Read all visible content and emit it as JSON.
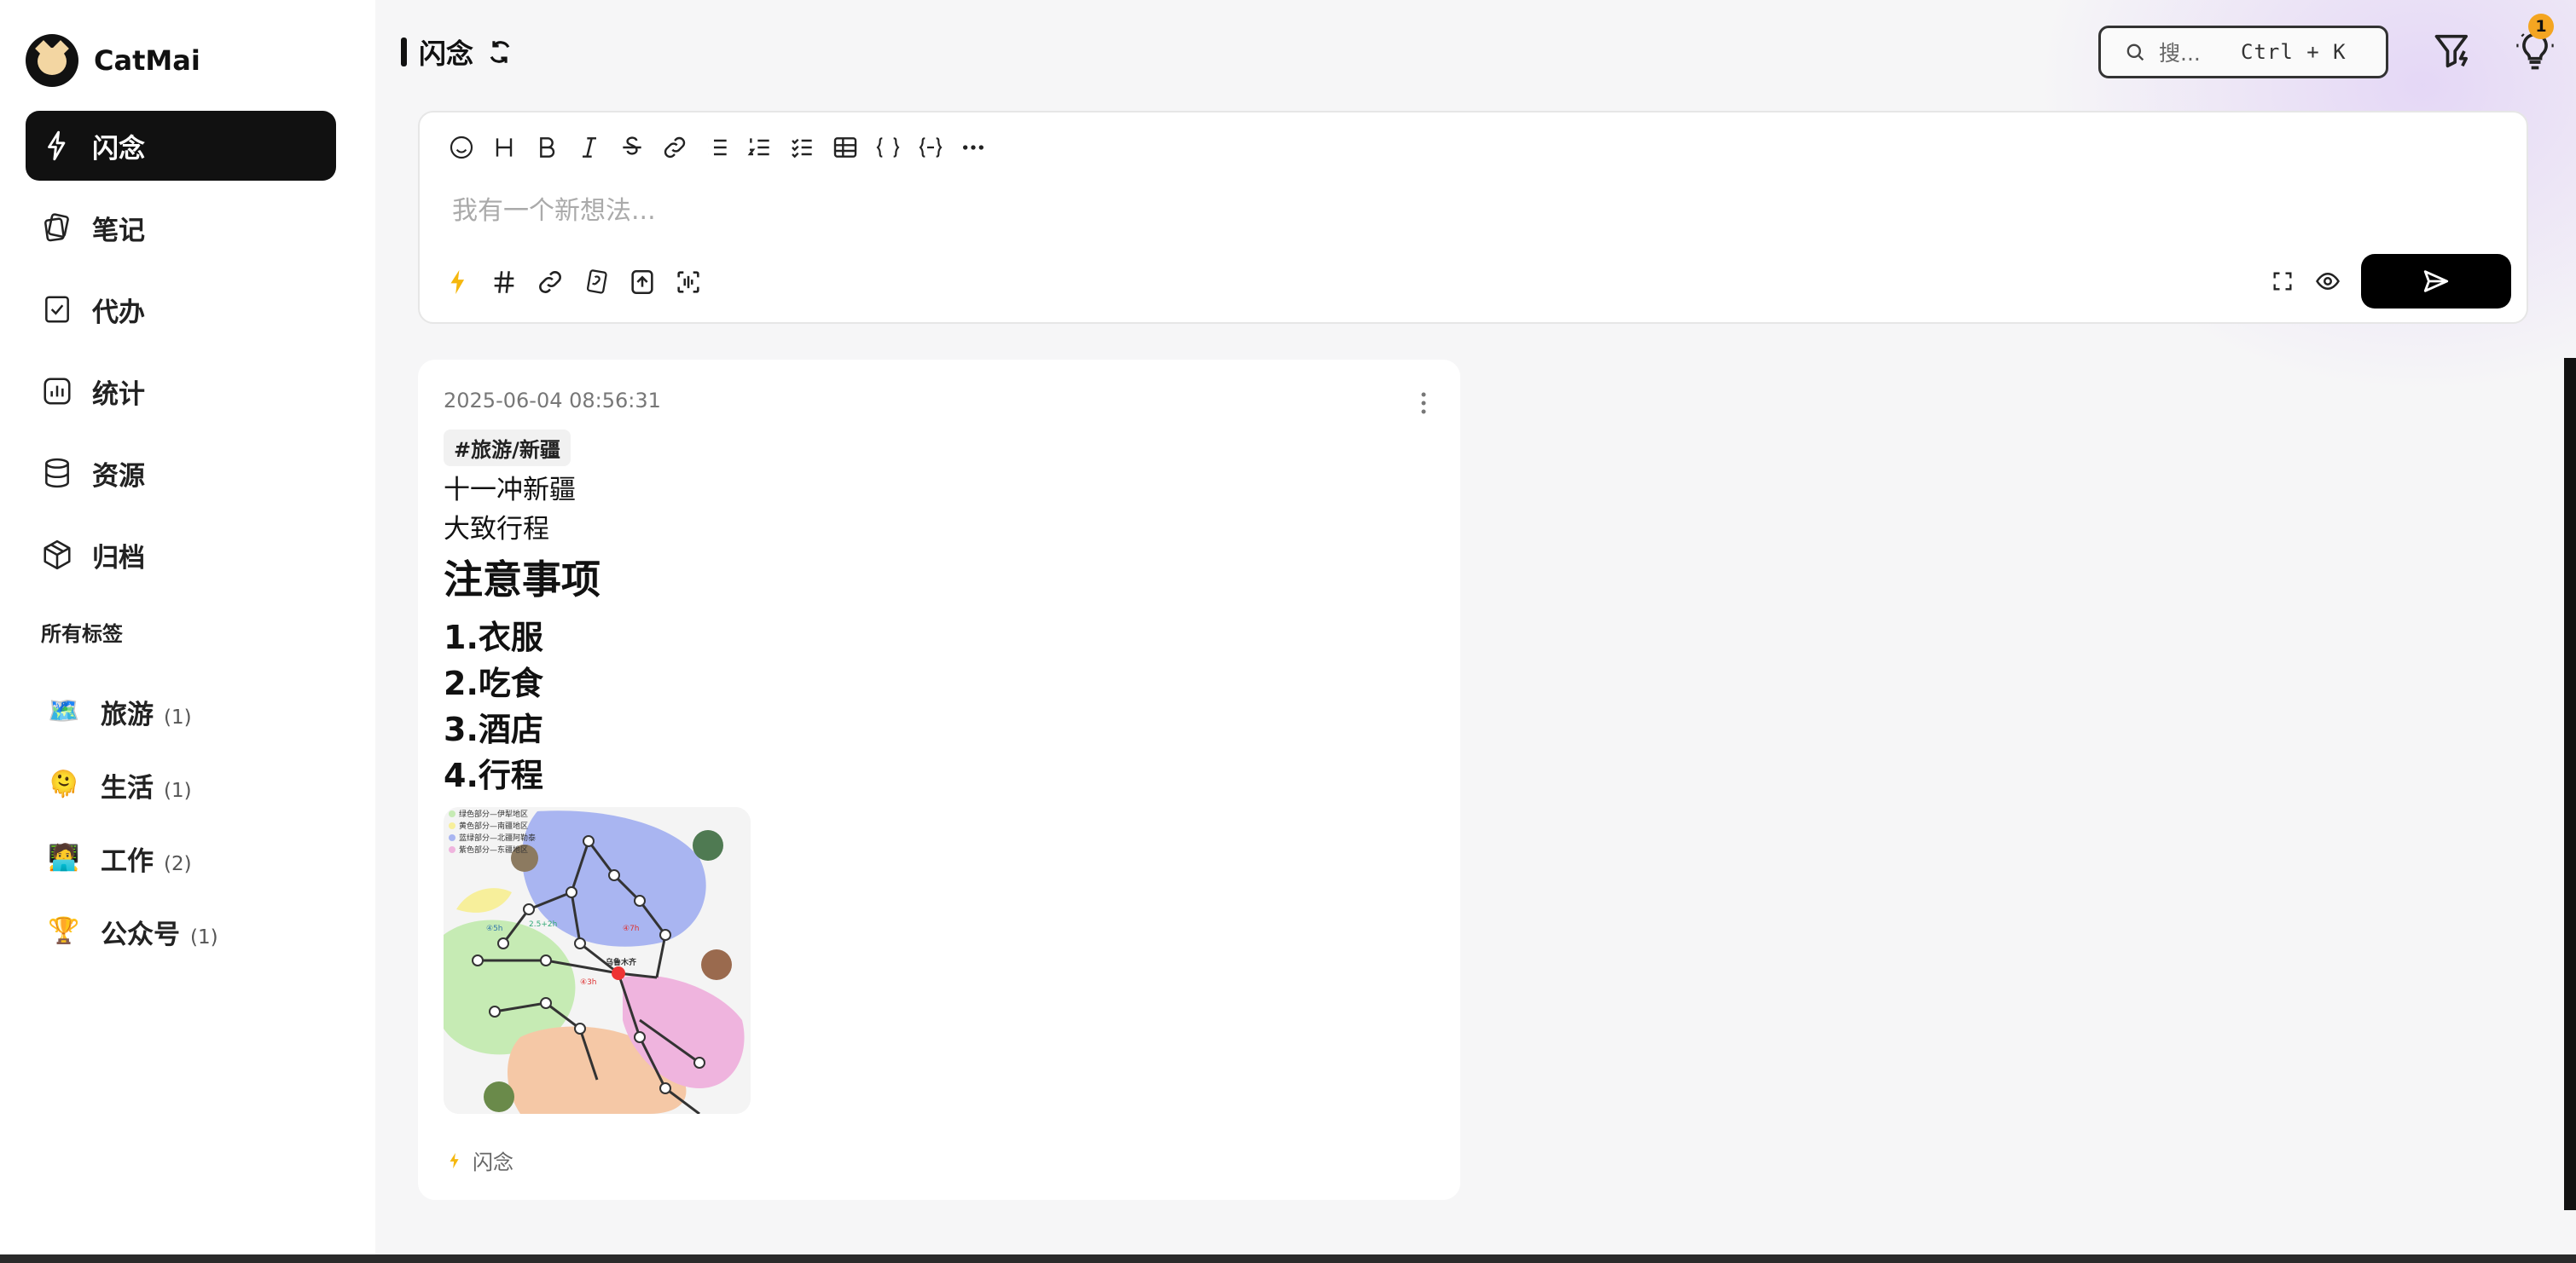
{
  "app": {
    "name": "CatMai"
  },
  "nav": [
    {
      "label": "闪念",
      "icon": "bolt-icon",
      "active": true
    },
    {
      "label": "笔记",
      "icon": "notes-icon"
    },
    {
      "label": "代办",
      "icon": "todo-icon"
    },
    {
      "label": "统计",
      "icon": "stats-icon"
    },
    {
      "label": "资源",
      "icon": "database-icon"
    },
    {
      "label": "归档",
      "icon": "archive-icon"
    }
  ],
  "tags_title": "所有标签",
  "tags": [
    {
      "emoji": "🗺️",
      "label": "旅游",
      "count": "(1)"
    },
    {
      "emoji": "🫠",
      "label": "生活",
      "count": "(1)"
    },
    {
      "emoji": "🧑‍💻",
      "label": "工作",
      "count": "(2)"
    },
    {
      "emoji": "🏆",
      "label": "公众号",
      "count": "(1)"
    }
  ],
  "header": {
    "title": "闪念",
    "search_placeholder": "搜...",
    "shortcut": "Ctrl + K",
    "badge": "1"
  },
  "editor": {
    "placeholder": "我有一个新想法...",
    "toolbar": [
      "emoji-icon",
      "heading",
      "bold",
      "italic",
      "strikethrough",
      "link",
      "bullet-list",
      "ordered-list",
      "task-list",
      "table",
      "code-inline",
      "code-block",
      "more"
    ]
  },
  "memo": {
    "date": "2025-06-04 08:56:31",
    "tag": "#旅游/新疆",
    "lines": [
      "十一冲新疆",
      "大致行程"
    ],
    "heading": "注意事项",
    "items": [
      "1.衣服",
      "2.吃食",
      "3.酒店",
      "4.行程"
    ],
    "footer": "闪念",
    "map_labels": [
      "绿色部分—伊犁地区",
      "黄色部分—南疆地区",
      "蓝绿部分—北疆阿勒泰",
      "紫色部分—东疆地区",
      "乌鲁木齐",
      "④7h",
      "④3h",
      "2.5+2h",
      "④5h"
    ]
  },
  "colors": {
    "accent": "#111111",
    "bolt": "#f5b70e",
    "badge": "#f4a521"
  }
}
